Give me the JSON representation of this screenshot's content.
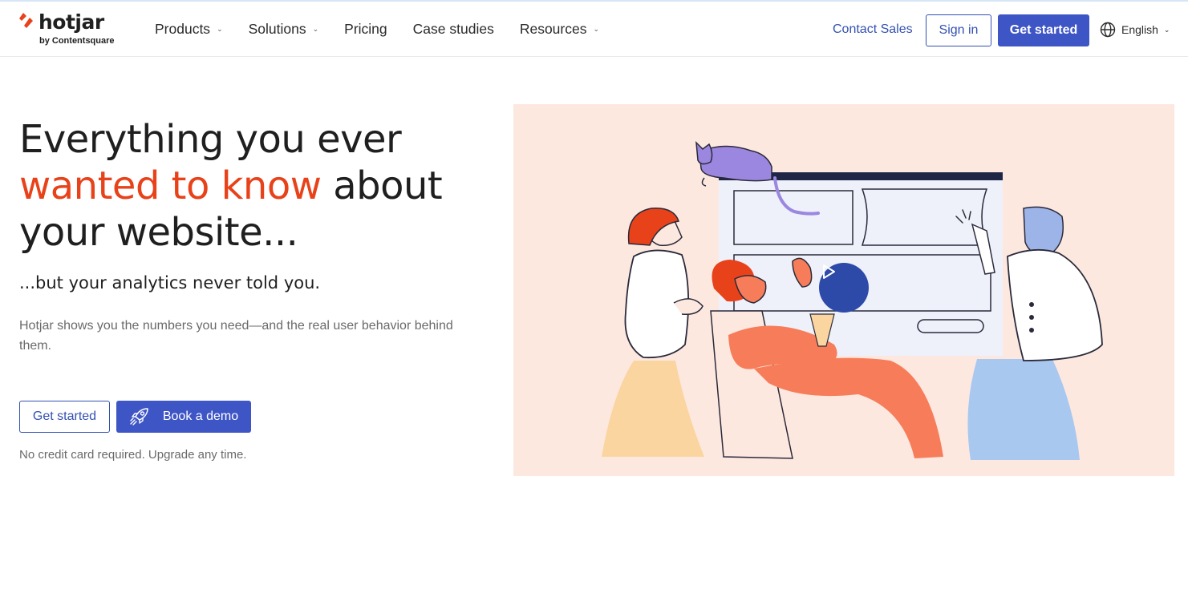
{
  "brand": {
    "name": "hotjar",
    "byline": "by Contentsquare",
    "accent_color": "#e8421a",
    "primary_color": "#3e55c6"
  },
  "nav": {
    "items": [
      {
        "label": "Products",
        "has_dropdown": true
      },
      {
        "label": "Solutions",
        "has_dropdown": true
      },
      {
        "label": "Pricing",
        "has_dropdown": false
      },
      {
        "label": "Case studies",
        "has_dropdown": false
      },
      {
        "label": "Resources",
        "has_dropdown": true
      }
    ],
    "contact_sales": "Contact Sales",
    "sign_in": "Sign in",
    "get_started": "Get started",
    "language": "English",
    "icons": {
      "language": "globe-icon",
      "dropdown": "chevron-down-icon"
    }
  },
  "hero": {
    "headline_part1": "Everything you ever",
    "headline_accent": "wanted to know",
    "headline_part2": " about your website...",
    "subheadline": "...but your analytics never told you.",
    "description": "Hotjar shows you the numbers you need—and the real user behavior behind them.",
    "cta_primary": "Get started",
    "cta_demo": "Book a demo",
    "note": "No credit card required. Upgrade any time.",
    "icons": {
      "demo": "rocket-icon",
      "video": "play-icon"
    }
  }
}
